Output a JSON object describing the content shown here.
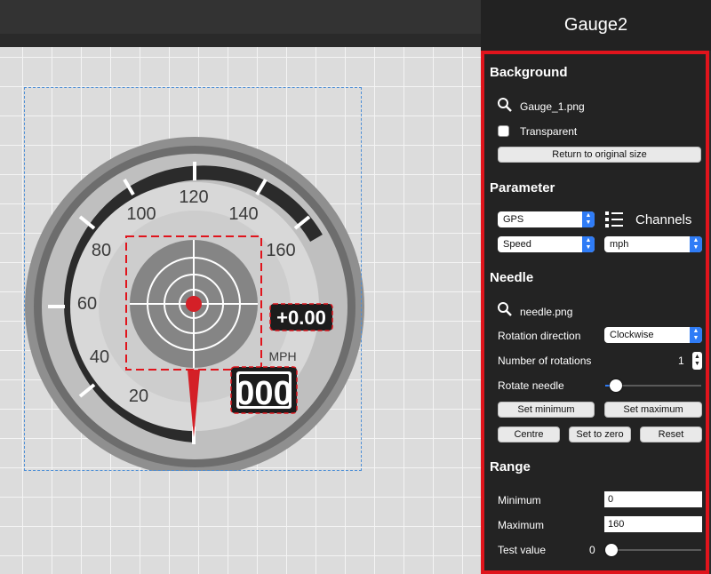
{
  "panel": {
    "title": "Gauge2",
    "background": {
      "heading": "Background",
      "file_name": "Gauge_1.png",
      "transparent_label": "Transparent",
      "transparent_checked": false,
      "reset_size_button": "Return to original size"
    },
    "parameter": {
      "heading": "Parameter",
      "source_select": "GPS",
      "channels_label": "Channels",
      "channel_select": "Speed",
      "unit_select": "mph"
    },
    "needle": {
      "heading": "Needle",
      "file_name": "needle.png",
      "rotation_direction_label": "Rotation direction",
      "rotation_direction_value": "Clockwise",
      "rotations_label": "Number of rotations",
      "rotations_value": "1",
      "rotate_needle_label": "Rotate needle",
      "rotate_needle_level": 0.08,
      "set_minimum": "Set minimum",
      "set_maximum": "Set maximum",
      "centre": "Centre",
      "set_to_zero": "Set to zero",
      "reset": "Reset"
    },
    "range": {
      "heading": "Range",
      "minimum_label": "Minimum",
      "minimum_value": "0",
      "maximum_label": "Maximum",
      "maximum_value": "160",
      "test_value_label": "Test value",
      "test_value": "0"
    }
  },
  "gauge": {
    "ticks": [
      "20",
      "40",
      "60",
      "80",
      "100",
      "120",
      "140",
      "160"
    ],
    "unit": "MPH",
    "offset_readout": "+0.00",
    "speed_readout": "000"
  },
  "colors": {
    "accent": "#2f7cf6",
    "highlight": "#e0141c",
    "panel_bg": "#232323"
  }
}
